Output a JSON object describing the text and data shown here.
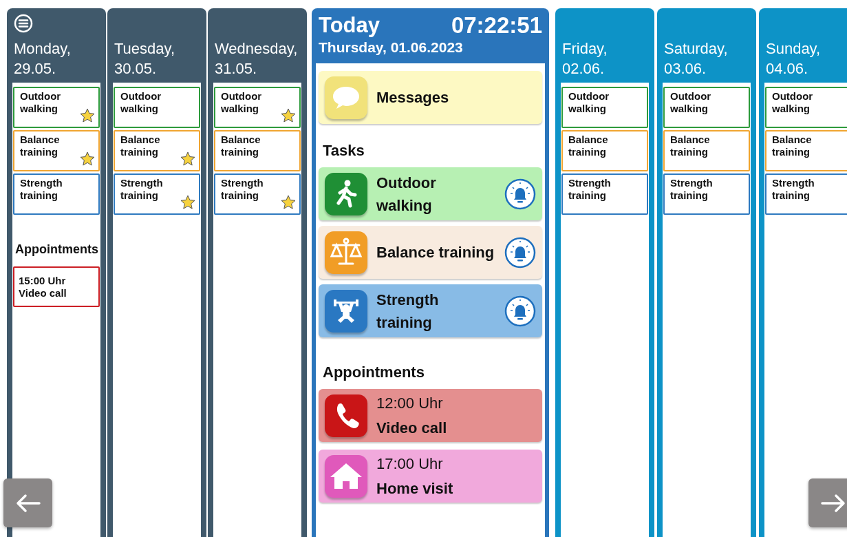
{
  "past_days": [
    {
      "day": "Monday,",
      "date": "29.05.",
      "tasks": [
        {
          "label": "Outdoor walking",
          "color": "#2e9b3c",
          "starred": true
        },
        {
          "label": "Balance training",
          "color": "#f0a531",
          "starred": true
        },
        {
          "label": "Strength training",
          "color": "#2f7ac0",
          "starred": false
        }
      ],
      "appointments_heading": "Appointments",
      "appointments": [
        {
          "time": "15:00 Uhr",
          "title": "Video call",
          "color": "#cc1f25"
        }
      ]
    },
    {
      "day": "Tuesday,",
      "date": "30.05.",
      "tasks": [
        {
          "label": "Outdoor walking",
          "color": "#2e9b3c",
          "starred": false
        },
        {
          "label": "Balance training",
          "color": "#f0a531",
          "starred": true
        },
        {
          "label": "Strength training",
          "color": "#2f7ac0",
          "starred": true
        }
      ]
    },
    {
      "day": "Wednesday,",
      "date": "31.05.",
      "tasks": [
        {
          "label": "Outdoor walking",
          "color": "#2e9b3c",
          "starred": true
        },
        {
          "label": "Balance training",
          "color": "#f0a531",
          "starred": false
        },
        {
          "label": "Strength training",
          "color": "#2f7ac0",
          "starred": true
        }
      ]
    }
  ],
  "today": {
    "title": "Today",
    "clock": "07:22:51",
    "date": "Thursday, 01.06.2023",
    "messages": "Messages",
    "tasks_heading": "Tasks",
    "tasks": [
      {
        "kind": "walking",
        "label": "Outdoor walking",
        "reminder": true
      },
      {
        "kind": "balance",
        "label": "Balance training",
        "reminder": true
      },
      {
        "kind": "strength",
        "label": "Strength training",
        "reminder": true
      }
    ],
    "appointments_heading": "Appointments",
    "appointments": [
      {
        "kind": "call",
        "time": "12:00 Uhr",
        "title": "Video call"
      },
      {
        "kind": "visit",
        "time": "17:00 Uhr",
        "title": "Home visit"
      }
    ]
  },
  "future_days": [
    {
      "day": "Friday,",
      "date": "02.06.",
      "tasks": [
        {
          "label": "Outdoor walking",
          "color": "#2e9b3c",
          "starred": false
        },
        {
          "label": "Balance training",
          "color": "#f0a531",
          "starred": false
        },
        {
          "label": "Strength training",
          "color": "#2f7ac0",
          "starred": false
        }
      ]
    },
    {
      "day": "Saturday,",
      "date": "03.06.",
      "tasks": [
        {
          "label": "Outdoor walking",
          "color": "#2e9b3c",
          "starred": false
        },
        {
          "label": "Balance training",
          "color": "#f0a531",
          "starred": false
        },
        {
          "label": "Strength training",
          "color": "#2f7ac0",
          "starred": false
        }
      ]
    },
    {
      "day": "Sunday,",
      "date": "04.06.",
      "tasks": [
        {
          "label": "Outdoor walking",
          "color": "#2e9b3c",
          "starred": false
        },
        {
          "label": "Balance training",
          "color": "#f0a531",
          "starred": false
        },
        {
          "label": "Strength training",
          "color": "#2f7ac0",
          "starred": false
        }
      ]
    }
  ]
}
